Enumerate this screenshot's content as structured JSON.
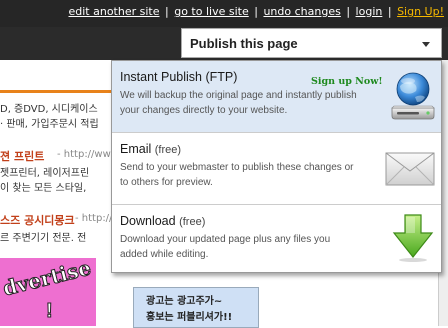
{
  "topbar": {
    "links": [
      {
        "label": "edit another site"
      },
      {
        "label": "go to live site"
      },
      {
        "label": "undo changes"
      },
      {
        "label": "login"
      },
      {
        "label": "Sign Up!"
      }
    ],
    "separator": "|"
  },
  "publish_button": {
    "label": "Publish this page"
  },
  "menu": {
    "items": [
      {
        "title": "Instant Publish (FTP)",
        "subtitle": "",
        "badge": "Sign up Now!",
        "description": "We will backup the original page and instantly publish your changes directly to your website.",
        "icon": "globe-drive-icon"
      },
      {
        "title": "Email",
        "subtitle": "(free)",
        "description": "Send to your webmaster to publish these changes or to others for preview.",
        "icon": "envelope-icon"
      },
      {
        "title": "Download",
        "subtitle": "(free)",
        "description": "Download your updated page plus any files you added while editing.",
        "icon": "download-arrow-icon"
      }
    ]
  },
  "background": {
    "lines": [
      "D, 증DVD, 시디케이스",
      "· 판매, 가입주문시 적립",
      "젼 프린트",
      "- http://www",
      "젯프린터, 레이저프린",
      "이 찾는 모든 스타일,",
      "스즈 공시디몽크",
      "- http://",
      "르 주변기기 전문. 전"
    ],
    "ad_left": [
      "dvertise",
      "!"
    ],
    "ad_mid": [
      "광고는 광고주가~",
      "홍보는 퍼블리셔가!!"
    ]
  },
  "colors": {
    "signup_link": "#f5b800",
    "badge": "#1f8a1f",
    "highlight": "#dde8f5"
  }
}
